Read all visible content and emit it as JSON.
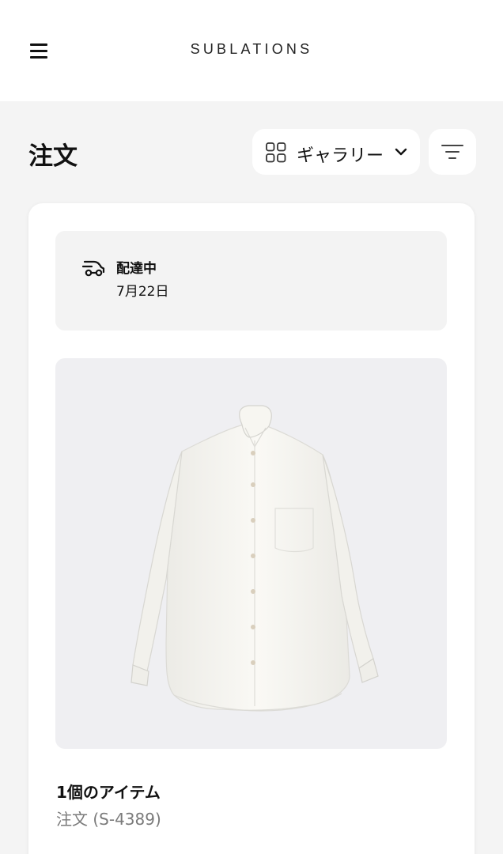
{
  "header": {
    "brand": "SUBLATIONS",
    "menu_icon": "hamburger-menu-icon"
  },
  "toolbar": {
    "title": "注文",
    "view_label": "ギャラリー",
    "view_icon": "grid-icon",
    "view_chevron_icon": "chevron-down-icon",
    "filter_icon": "filter-icon"
  },
  "order": {
    "status_icon": "delivery-truck-icon",
    "status": "配達中",
    "date": "7月22日",
    "product_image_subject": "white-button-up-shirt",
    "item_count": "1個のアイテム",
    "order_number": "注文 (S-4389)"
  },
  "colors": {
    "page_background": "#f4f4f4",
    "surface": "#ffffff",
    "status_background": "#f3f3f3",
    "image_background": "#efeff2",
    "text_primary": "#111111",
    "text_secondary": "#7a7a7a"
  }
}
